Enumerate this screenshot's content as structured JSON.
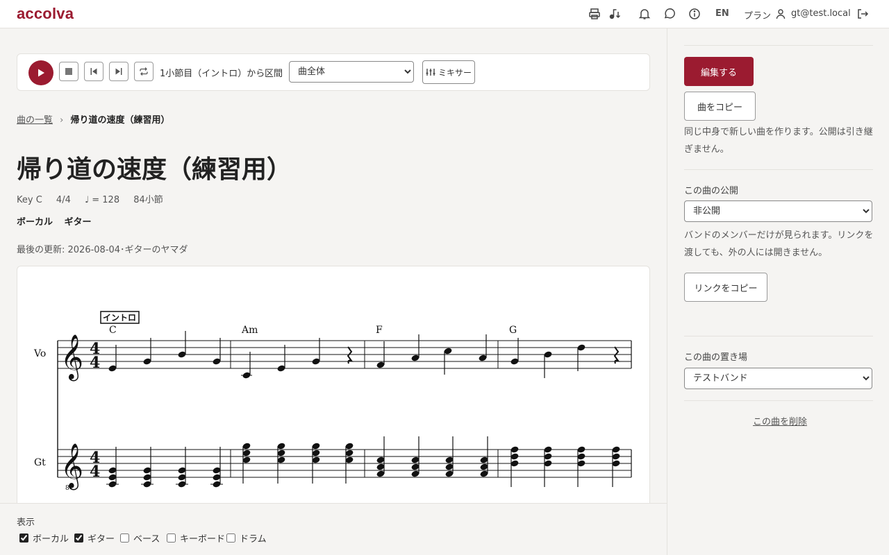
{
  "header": {
    "logo": "accolva",
    "lang": "EN",
    "plan": "プラン",
    "user": "gt@test.local",
    "icons": [
      "print-icon",
      "tuner-icon",
      "bell-icon",
      "chat-icon",
      "info-icon",
      "user-icon",
      "logout-icon"
    ]
  },
  "transport": {
    "position_label": "1小節目（イントロ）から",
    "range_label": "区間",
    "range_value": "曲全体",
    "mixer_label": "ミキサー"
  },
  "breadcrumb": {
    "parent": "曲の一覧",
    "sep": "›",
    "current": "帰り道の速度（練習用）"
  },
  "song": {
    "title": "帰り道の速度（練習用）",
    "key": "Key C",
    "time": "4/4",
    "tempo": "♩ = 128",
    "measures": "84小節",
    "parts": [
      "ボーカル",
      "ギター"
    ],
    "updated": "最後の更新: 2026-08-04･ギターのヤマダ"
  },
  "score": {
    "rehearsal_mark": "イントロ",
    "chords": [
      "C",
      "Am",
      "F",
      "G"
    ],
    "staff_labels": [
      "Vo",
      "Gt"
    ]
  },
  "view": {
    "title": "表示",
    "options": [
      {
        "label": "ボーカル",
        "checked": true
      },
      {
        "label": "ギター",
        "checked": true
      },
      {
        "label": "ベース",
        "checked": false
      },
      {
        "label": "キーボード",
        "checked": false
      },
      {
        "label": "ドラム",
        "checked": false
      }
    ]
  },
  "sidebar": {
    "edit": "編集する",
    "copy": "曲をコピー",
    "copy_note": "同じ中身で新しい曲を作ります。公開は引き継ぎません。",
    "publish_label": "この曲の公開",
    "publish_value": "非公開",
    "publish_note": "バンドのメンバーだけが見られます。リンクを渡しても、外の人には開きません。",
    "copy_link": "リンクをコピー",
    "place_label": "この曲の置き場",
    "place_value": "テストバンド",
    "delete": "この曲を削除"
  },
  "colors": {
    "accent": "#9b1b30",
    "background": "#f5f4f2"
  }
}
